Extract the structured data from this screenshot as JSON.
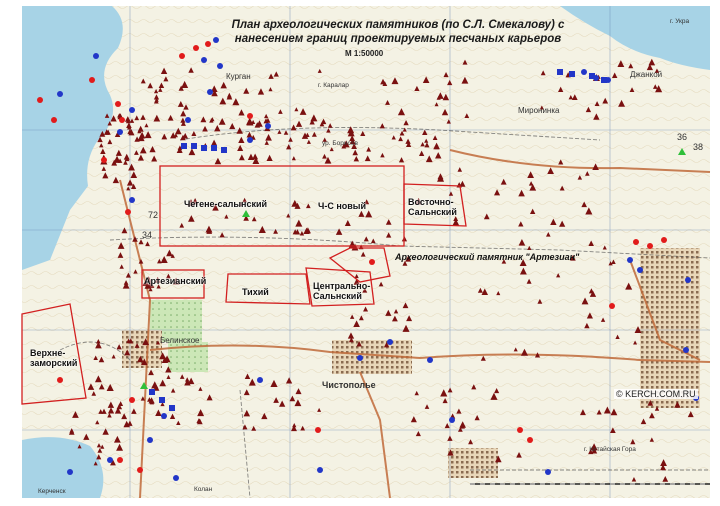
{
  "map": {
    "title_line1": "План археологических памятников (по С.Л. Смекалову) с",
    "title_line2": "нанесением границ проектируемых песчаных карьеров",
    "scale": "М 1:50000",
    "watermark": "© KERCH.COM.RU",
    "artezian_note": "Археологический памятник \"Артезиан\"",
    "quarries": [
      {
        "id": "chegene",
        "label": "Чегене-салынский"
      },
      {
        "id": "chs-new",
        "label": "Ч-С новый"
      },
      {
        "id": "vostochno",
        "label": "Восточно-Сальнский"
      },
      {
        "id": "artezian",
        "label": "Артезианский"
      },
      {
        "id": "tikhiy",
        "label": "Тихий"
      },
      {
        "id": "centralno",
        "label": "Центрально-Сальнский"
      },
      {
        "id": "verkhne",
        "label": "Верхне-заморский"
      }
    ],
    "place_names": {
      "kurgan": "Курган",
      "karalar": "г. Каралар",
      "mironinka": "Миронинка",
      "belinskoe": "Белинское",
      "chistopolye": "Чистополье",
      "kitayskaya_gora": "г. Китайская Гора",
      "dzhankoy": "Джанкой",
      "ukrain": "г. Укра",
      "kolan": "Колан",
      "kerchensk": "Керченск",
      "barisovo": "ур. Борисов"
    },
    "grid_numbers": {
      "n36": "36",
      "n72": "72",
      "n34": "34",
      "n38": "38"
    },
    "colors": {
      "water": "#a7d3e6",
      "land": "#f4f2e4",
      "monument": "#7a1010",
      "quarry_border": "#d22020",
      "red_marker": "#e11b1b",
      "blue_marker": "#2236c8",
      "green_marker": "#2fbf3a"
    }
  }
}
